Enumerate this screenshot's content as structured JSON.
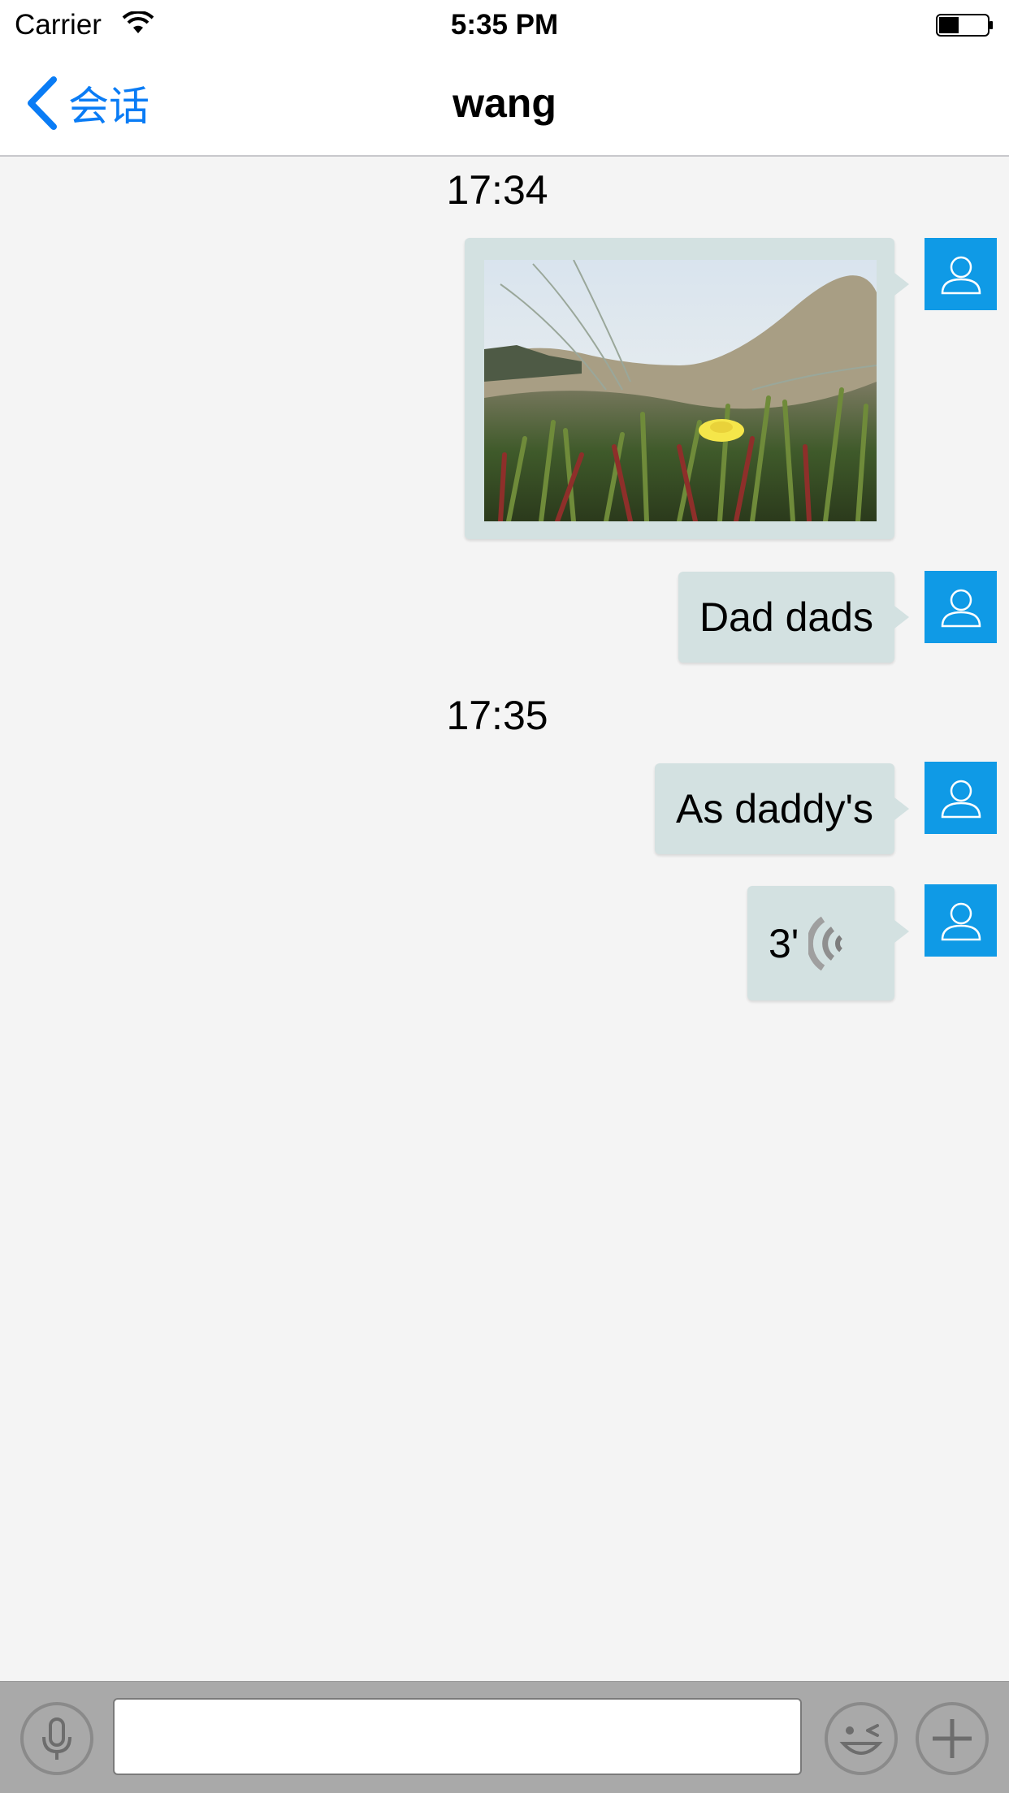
{
  "status_bar": {
    "carrier": "Carrier",
    "time": "5:35 PM",
    "wifi_icon": "wifi-icon",
    "battery_icon": "battery-icon",
    "battery_level": 0.4
  },
  "nav": {
    "back_label": "会话",
    "title": "wang",
    "accent_color": "#0a7cf5"
  },
  "chat": {
    "timestamps": [
      "17:34",
      "17:35"
    ],
    "messages": [
      {
        "type": "image",
        "sender": "self",
        "content": "photo of grass and a yellow flower on a sand dune"
      },
      {
        "type": "text",
        "sender": "self",
        "text": "Dad dads"
      },
      {
        "type": "text",
        "sender": "self",
        "text": "As daddy's"
      },
      {
        "type": "voice",
        "sender": "self",
        "duration": "3'"
      }
    ],
    "avatar_color": "#0f9ae6",
    "bubble_color": "#d3e1e1"
  },
  "input_bar": {
    "text_value": "",
    "mic_icon": "microphone-icon",
    "emoji_icon": "emoji-icon",
    "plus_icon": "plus-icon"
  }
}
